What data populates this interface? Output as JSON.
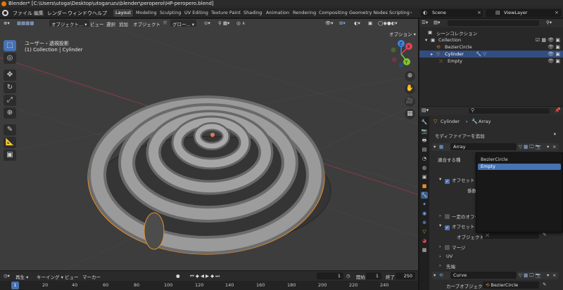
{
  "window": {
    "title": "Blender* [C:\\Users\\utoga\\Desktop\\utogaruzu\\blender\\peroperoi\\HP-peropero.blend]"
  },
  "menu": {
    "items": [
      "ファイル",
      "編集",
      "レンダー",
      "ウィンドウ",
      "ヘルプ"
    ],
    "workspaces": [
      "Layout",
      "Modeling",
      "Sculpting",
      "UV Editing",
      "Texture Paint",
      "Shading",
      "Animation",
      "Rendering",
      "Compositing",
      "Geometry Nodes",
      "Scripting"
    ],
    "active_workspace": "Layout",
    "scene_label": "Scene",
    "view_layer_label": "ViewLayer"
  },
  "viewport": {
    "mode": "オブジェクト...",
    "view_menu": "ビュー",
    "select_menu": "選択",
    "add_menu": "追加",
    "object_menu": "オブジェクト",
    "orientation": "グロー...",
    "options_label": "オプション",
    "info_line1": "ユーザー・透視投影",
    "info_line2": "(1) Collection | Cylinder",
    "gizmo": {
      "x_label": "X",
      "y_label": "Y",
      "z_label": "Z"
    }
  },
  "outliner": {
    "root": "シーンコレクション",
    "collection": "Collection",
    "objects": [
      {
        "name": "BezierCircle",
        "selected": false
      },
      {
        "name": "Cylinder",
        "selected": true
      },
      {
        "name": "Empty",
        "selected": false
      }
    ]
  },
  "properties": {
    "search_placeholder": "",
    "object_name": "Cylinder",
    "modifier_tab": "Array",
    "add_modifier": "モディファイアーを追加",
    "modifier_name": "Array",
    "fit_label": "適合する種",
    "offset_relative": "オフセット (係",
    "factor_label": "係数",
    "constant_offset": "一定のオフセ",
    "object_offset": "オフセット (O",
    "object_label": "オブジェクト",
    "merge_label": "マージ",
    "uv_label": "UV",
    "caps_label": "先端",
    "curve_modifier_name": "Curve",
    "curve_object_label": "カーブオブジェクト",
    "curve_object_value": "BezierCircle"
  },
  "dropdown": {
    "items": [
      {
        "label": "BezierCircle",
        "selected": false
      },
      {
        "label": "Empty",
        "selected": true
      }
    ]
  },
  "timeline": {
    "playback": "再生",
    "keying": "キーイング",
    "view": "ビュー",
    "marker": "マーカー",
    "current_frame": "1",
    "start_label": "開始",
    "start_value": "1",
    "end_label": "終了",
    "end_value": "250",
    "ruler_marks": [
      "20",
      "40",
      "60",
      "80",
      "100",
      "120",
      "140",
      "160",
      "180",
      "200",
      "220",
      "240"
    ],
    "frame_marker": "1"
  },
  "colors": {
    "accent": "#4772b3",
    "selection_outline": "#e8902a",
    "x_axis": "#e0415a",
    "y_axis": "#85c534",
    "z_axis": "#3d84e6"
  }
}
